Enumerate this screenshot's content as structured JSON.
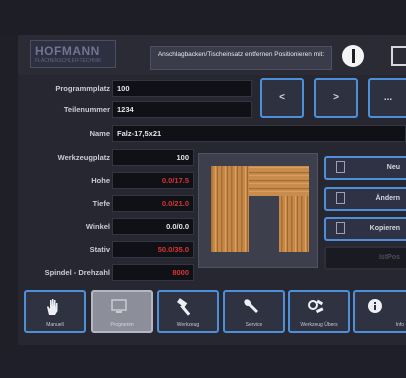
{
  "header": {
    "logo_text": "HOFMANN",
    "logo_sub": "FLÄCHENSCHLEIFTECHNIK",
    "message": "Anschlagbacken/Tischeinsatz entfernen Positionieren mit:"
  },
  "fields": {
    "programmplatz": {
      "label": "Programmplatz",
      "value": "100"
    },
    "teilenummer": {
      "label": "Teilenummer",
      "value": "1234"
    },
    "name": {
      "label": "Name",
      "value": "Falz-17,5x21"
    },
    "werkzeugplatz": {
      "label": "Werkzeugplatz",
      "value": "100"
    },
    "hohe": {
      "label": "Hohe",
      "value": "0.0/17.5"
    },
    "tiefe": {
      "label": "Tiefe",
      "value": "0.0/21.0"
    },
    "winkel": {
      "label": "Winkel",
      "value": "0.0/0.0"
    },
    "stativ": {
      "label": "Stativ",
      "value": "50.0/35.0"
    },
    "spindel": {
      "label": "Spindel - Drehzahl",
      "value": "8000"
    }
  },
  "nav": {
    "prev": "<",
    "next": ">",
    "more": "..."
  },
  "actions": {
    "new": "Neu",
    "edit": "Ändern",
    "copy": "Kopieren",
    "disabled": "IstPos"
  },
  "tabs": {
    "manuell": "Manuell",
    "programm": "Programm",
    "werkzeug": "Werkzeug",
    "service": "Service",
    "werkzeug_ubers": "Werkzeug Übers",
    "info": "Info"
  },
  "colors": {
    "accent_blue": "#4d8fd8",
    "value_red": "#d63434",
    "background": "#262731"
  }
}
